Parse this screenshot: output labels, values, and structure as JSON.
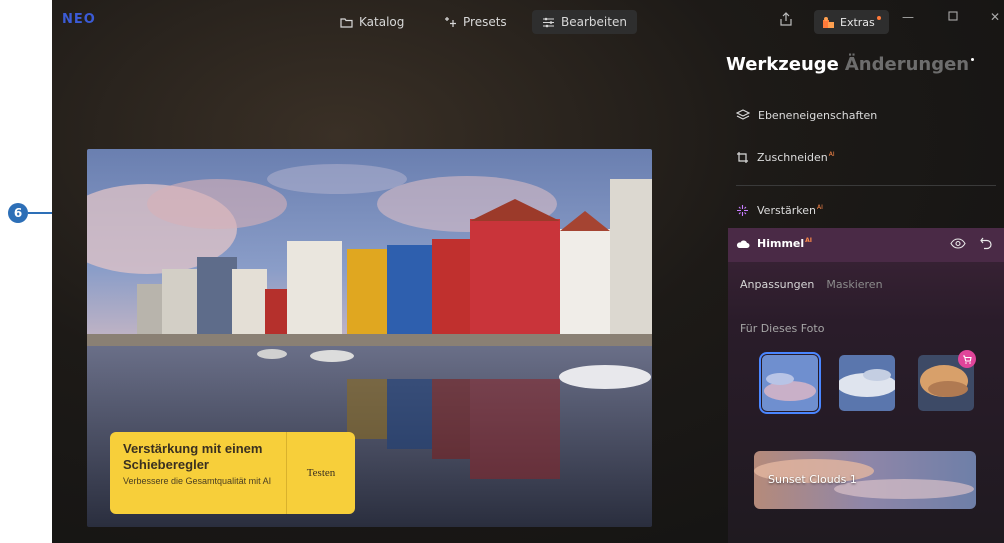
{
  "callout": {
    "number": "6"
  },
  "app": {
    "logo": "NEO"
  },
  "nav": {
    "catalog": "Katalog",
    "presets": "Presets",
    "edit": "Bearbeiten",
    "extras": "Extras"
  },
  "panel": {
    "title": "Werkzeuge",
    "title_inactive": "Änderungen",
    "tools": {
      "layer_props": "Ebeneneigenschaften",
      "crop": "Zuschneiden",
      "enhance": "Verstärken",
      "ai_badge": "AI"
    },
    "sky": {
      "label": "Himmel",
      "tab_adjust": "Anpassungen",
      "tab_mask": "Maskieren",
      "for_this_photo": "Für Dieses Foto",
      "preset_name": "Sunset Clouds 1"
    }
  },
  "promo": {
    "title": "Verstärkung mit einem Schieberegler",
    "desc": "Verbessere die Gesamtqualität mit AI",
    "button": "Testen"
  },
  "colors": {
    "accent_blue": "#2d6fb7",
    "promo_yellow": "#f7cf3a",
    "ai_orange": "#ff8a4a",
    "selected_outline": "#4a86ff",
    "shop_badge": "#e0459a"
  }
}
